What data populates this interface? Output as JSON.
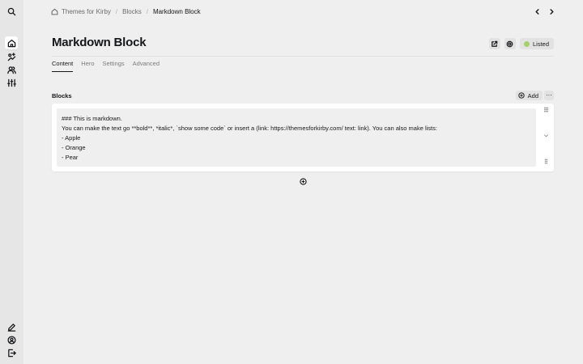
{
  "breadcrumb": {
    "items": [
      "Themes for Kirby",
      "Blocks",
      "Markdown Block"
    ]
  },
  "sidebar": {
    "top_icons": [
      "search-icon",
      "home-icon",
      "image-icon",
      "users-icon",
      "sliders-icon"
    ],
    "bottom_icons": [
      "edit-icon",
      "account-icon",
      "logout-icon"
    ]
  },
  "page": {
    "title": "Markdown Block",
    "status_label": "Listed",
    "status_color": "#a7d16e"
  },
  "tabs": [
    {
      "label": "Content",
      "active": true
    },
    {
      "label": "Hero",
      "active": false
    },
    {
      "label": "Settings",
      "active": false
    },
    {
      "label": "Advanced",
      "active": false
    }
  ],
  "blocks": {
    "label": "Blocks",
    "add_label": "Add",
    "more_label": "···",
    "markdown_lines": [
      "### This is markdown.",
      "You can make the text go **bold**, *italic*, `show some code` or insert a (link: https://themesforkirby.com/ text: link). You can also make lists:",
      "- Apple",
      "- Orange",
      "- Pear"
    ]
  }
}
